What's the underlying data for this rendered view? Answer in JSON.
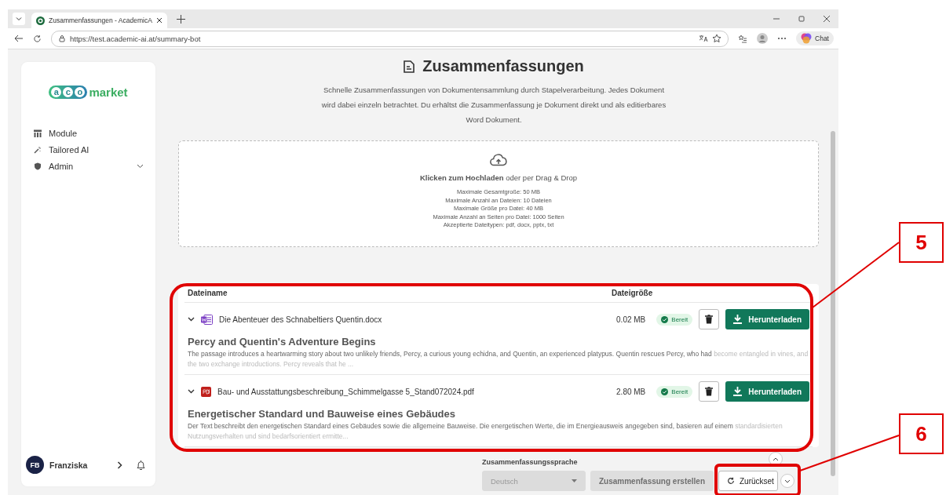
{
  "browser": {
    "tab_title": "Zusammenfassungen - AcademicA",
    "url": "https://test.academic-ai.at/summary-bot",
    "chat_label": "Chat"
  },
  "sidebar": {
    "logo": {
      "letters": [
        "a",
        "c",
        "o"
      ],
      "word": "market"
    },
    "items": [
      {
        "label": "Module",
        "kind": "table"
      },
      {
        "label": "Tailored AI",
        "kind": "wand"
      },
      {
        "label": "Admin",
        "kind": "admin",
        "expandable": true
      }
    ],
    "user": {
      "initials": "FB",
      "name": "Franziska"
    }
  },
  "page": {
    "title": "Zusammenfassungen",
    "description": "Schnelle Zusammenfassungen von Dokumentensammlung durch Stapelverarbeitung. Jedes Dokument wird dabei einzeln betrachtet. Du erhältst die Zusammenfassung je Dokument direkt und als editierbares Word Dokument."
  },
  "upload": {
    "prompt": "**Klicken zum Hochladen** oder per Drag & Drop",
    "limits": [
      "Maximale Gesamtgroße: 50 MB",
      "Maximale Anzahl an Dateien: 10 Dateien",
      "Maximale Größe pro Datei: 40 MB",
      "Maximale Anzahl an Seiten pro Datei: 1000 Seiten",
      "Akzeptierte Dateitypen: pdf, docx, pptx, txt"
    ]
  },
  "table": {
    "columns": [
      "Dateiname",
      "Dateigröße"
    ],
    "rows": [
      {
        "kind": "docx",
        "name": "Die Abenteuer des Schnabeltiers Quentin.docx",
        "size": "0.02 MB",
        "status": "Bereit",
        "download": "Herunterladen",
        "summary_title": "Percy and Quentin's Adventure Begins",
        "summary": "The passage introduces a heartwarming story about two unlikely friends, Percy, a curious young echidna, and Quentin, an experienced platypus. Quentin rescues Percy, who had",
        "summary_more": "become entangled in vines, and the two exchange introductions. Percy reveals that he ..."
      },
      {
        "kind": "pdf",
        "name": "Bau- und Ausstattungsbeschreibung_Schimmelgasse 5_Stand072024.pdf",
        "size": "2.80 MB",
        "status": "Bereit",
        "download": "Herunterladen",
        "summary_title": "Energetischer Standard und Bauweise eines Gebäudes",
        "summary": "Der Text beschreibt den energetischen Standard eines Gebäudes sowie die allgemeine Bauweise. Die energetischen Werte, die im Energieausweis angegeben sind, basieren auf einem",
        "summary_more": "standardisierten Nutzungsverhalten und sind bedarfsorientiert ermitte..."
      }
    ]
  },
  "controls": {
    "language_label": "Zusammenfassungssprache",
    "language": "Deutsch",
    "language_disabled": true,
    "create": "Zusammenfassung erstellen",
    "create_disabled": true,
    "reset": "Zurückset"
  },
  "annotations": [
    {
      "label": "5"
    },
    {
      "label": "6"
    }
  ]
}
